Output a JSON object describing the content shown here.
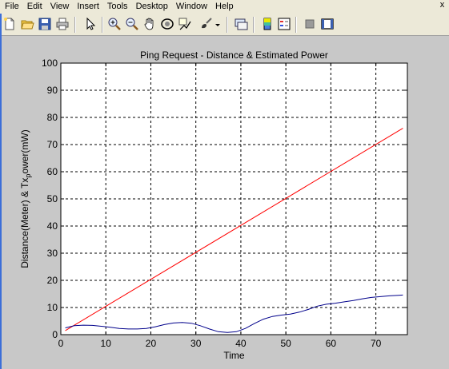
{
  "menu": {
    "items": [
      "File",
      "Edit",
      "View",
      "Insert",
      "Tools",
      "Desktop",
      "Window",
      "Help"
    ],
    "close_glyph": "x"
  },
  "toolbar": {
    "buttons": [
      "new-figure-icon",
      "open-file-icon",
      "save-icon",
      "print-icon",
      "select-arrow-icon",
      "zoom-in-icon",
      "zoom-out-icon",
      "pan-hand-icon",
      "rotate-3d-icon",
      "data-cursor-icon",
      "brush-icon",
      "link-icon",
      "colorbar-icon",
      "legend-icon",
      "hide-plot-tools-icon",
      "show-plot-tools-icon"
    ]
  },
  "colors": {
    "series_red": "#ff0000",
    "series_blue": "#00008b",
    "figure_bg": "#c8c8c8"
  },
  "chart_data": {
    "type": "line",
    "title": "Ping Request - Distance & Estimated Power",
    "xlabel": "Time",
    "ylabel": "Distance(Meter) & Tx",
    "ylabel_sub": "p",
    "ylabel_tail": "ower(mW)",
    "xlim": [
      0,
      77
    ],
    "ylim": [
      0,
      100
    ],
    "xticks": [
      0,
      10,
      20,
      30,
      40,
      50,
      60,
      70
    ],
    "yticks": [
      0,
      10,
      20,
      30,
      40,
      50,
      60,
      70,
      80,
      90,
      100
    ],
    "grid": true,
    "series": [
      {
        "color": "#ff0000",
        "x": [
          1,
          76
        ],
        "y": [
          1.5,
          76
        ]
      },
      {
        "color": "#00008b",
        "x": [
          1,
          3,
          5,
          7,
          9,
          11,
          13,
          15,
          17,
          19,
          21,
          23,
          25,
          27,
          29,
          31,
          33,
          35,
          37,
          39,
          41,
          43,
          45,
          47,
          49,
          51,
          53,
          55,
          57,
          59,
          61,
          63,
          65,
          67,
          69,
          71,
          73,
          75,
          76
        ],
        "y": [
          2.5,
          3.3,
          3.5,
          3.4,
          3.1,
          2.7,
          2.3,
          2.1,
          2.1,
          2.3,
          2.9,
          3.7,
          4.3,
          4.5,
          4.2,
          3.3,
          2.1,
          1.1,
          0.8,
          1.1,
          2.3,
          4.1,
          5.7,
          6.7,
          7.2,
          7.6,
          8.3,
          9.3,
          10.5,
          11.2,
          11.6,
          12.1,
          12.6,
          13.2,
          13.7,
          14.0,
          14.3,
          14.5,
          14.6
        ]
      }
    ]
  }
}
